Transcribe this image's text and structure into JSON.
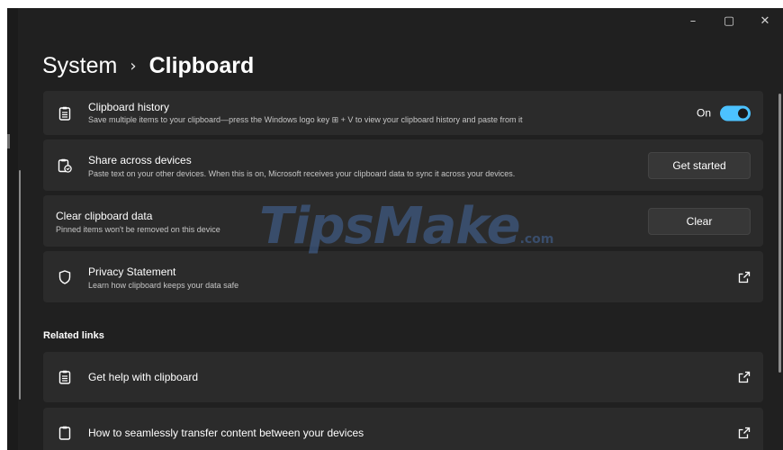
{
  "window": {
    "caption": {
      "minimize": "–",
      "maximize": "▢",
      "close": "✕"
    }
  },
  "breadcrumb": {
    "parent": "System",
    "separator": "›",
    "current": "Clipboard"
  },
  "cards": {
    "history": {
      "title": "Clipboard history",
      "desc": "Save multiple items to your clipboard—press the Windows logo key ⊞ + V to view your clipboard history and paste from it",
      "toggle_label": "On",
      "toggle_on": true
    },
    "share": {
      "title": "Share across devices",
      "desc": "Paste text on your other devices. When this is on, Microsoft receives your clipboard data to sync it across your devices.",
      "button": "Get started"
    },
    "clear": {
      "title": "Clear clipboard data",
      "desc": "Pinned items won't be removed on this device",
      "button": "Clear"
    },
    "privacy": {
      "title": "Privacy Statement",
      "desc": "Learn how clipboard keeps your data safe"
    }
  },
  "related": {
    "heading": "Related links",
    "items": [
      {
        "label": "Get help with clipboard"
      },
      {
        "label": "How to seamlessly transfer content between your devices"
      }
    ]
  },
  "watermark": {
    "text": "TipsMake",
    "suffix": ".com"
  },
  "colors": {
    "accent": "#4cc2ff",
    "card": "#2b2b2b",
    "background": "#202020"
  }
}
